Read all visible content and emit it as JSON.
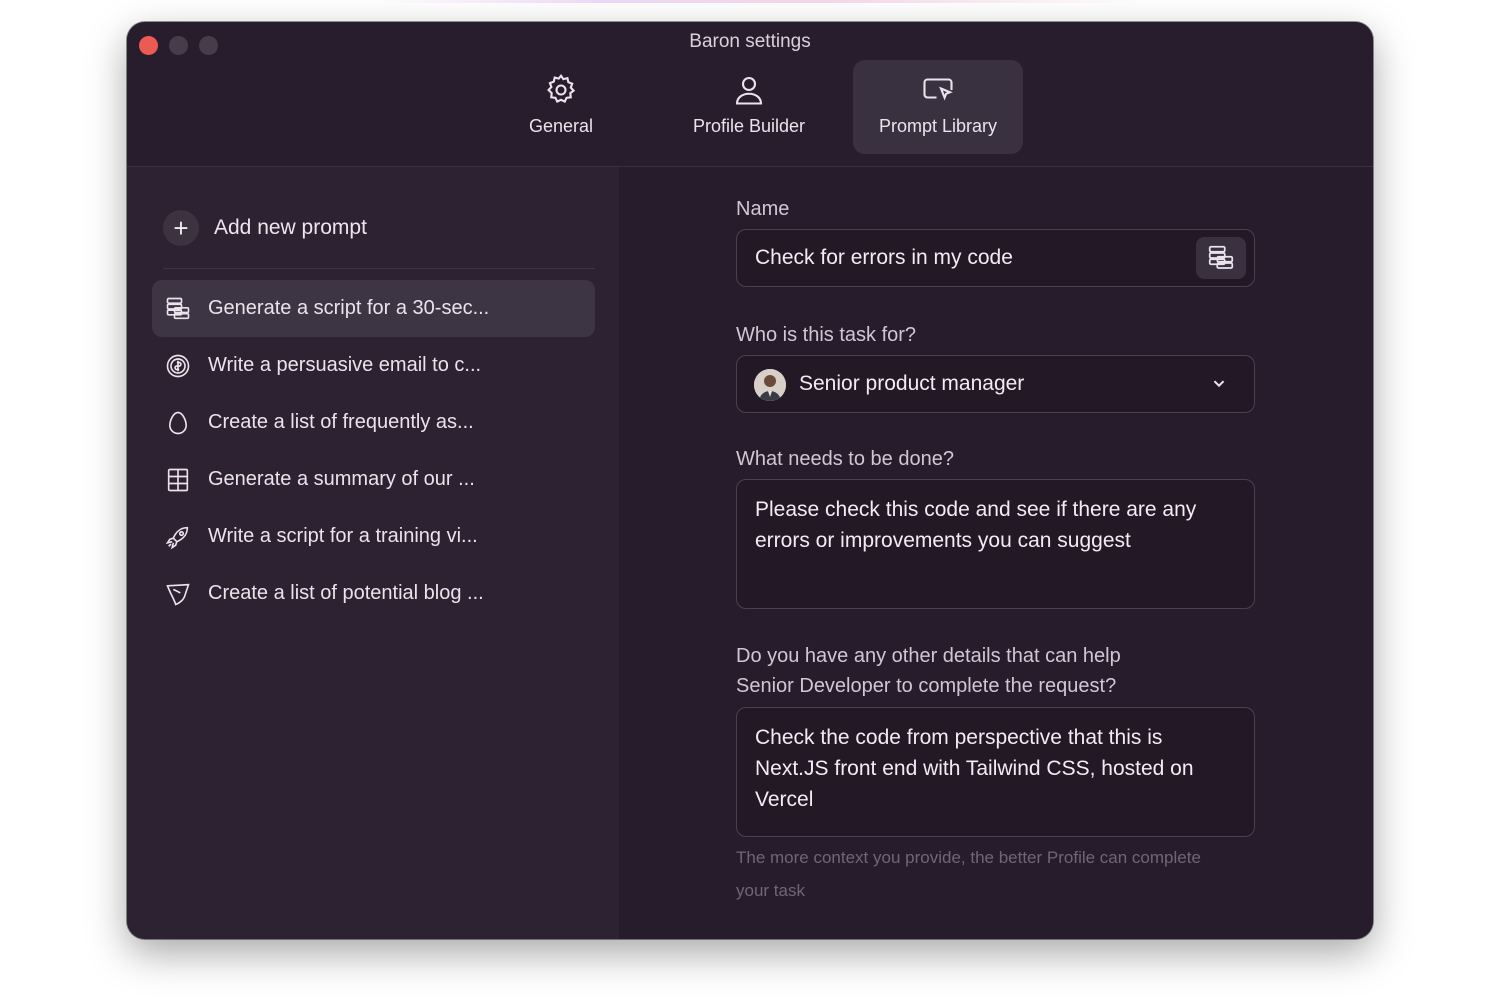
{
  "window": {
    "title": "Baron settings"
  },
  "tabs": [
    {
      "label": "General",
      "icon": "gear-icon"
    },
    {
      "label": "Profile Builder",
      "icon": "user-icon"
    },
    {
      "label": "Prompt Library",
      "icon": "cursor-window-icon",
      "active": true
    }
  ],
  "sidebar": {
    "add_label": "Add new prompt",
    "items": [
      {
        "label": "Generate a script for a 30-sec...",
        "icon": "database-icon",
        "active": true
      },
      {
        "label": "Write a persuasive email to c...",
        "icon": "coin-icon"
      },
      {
        "label": "Create a list of frequently as...",
        "icon": "egg-icon"
      },
      {
        "label": "Generate a summary of our ...",
        "icon": "building-icon"
      },
      {
        "label": "Write a script for a training vi...",
        "icon": "rocket-icon"
      },
      {
        "label": "Create a list of potential blog ...",
        "icon": "shield-icon"
      }
    ]
  },
  "form": {
    "name_label": "Name",
    "name_value": "Check for errors in my code",
    "who_label": "Who is this task for?",
    "who_value": "Senior product manager",
    "what_label": "What needs to be done?",
    "what_value": "Please check this code and see if there are any errors or improvements you can suggest",
    "details_label_line1": "Do you have any other details that can help",
    "details_label_line2": "Senior Developer to complete the request?",
    "details_value": "Check the code from perspective that this is Next.JS front end with Tailwind CSS, hosted on Vercel",
    "hint": "The more context you provide, the better Profile can complete your task"
  },
  "colors": {
    "window_bg": "#2a1f2f",
    "close_button": "#ec5a54",
    "active_item_bg": "#3e3544"
  }
}
